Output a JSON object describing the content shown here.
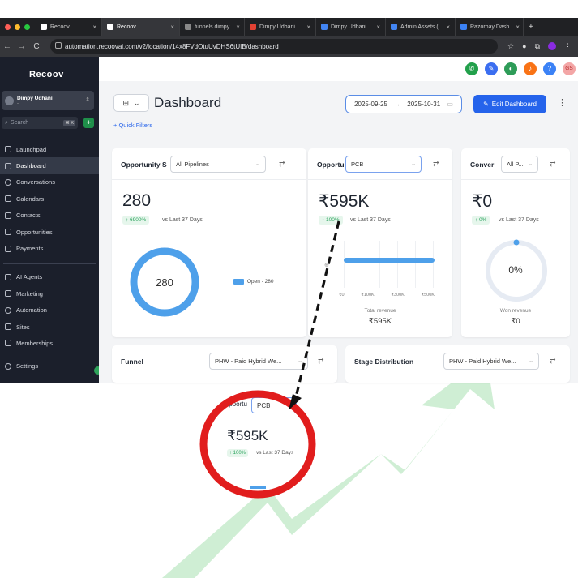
{
  "browser": {
    "tabs": [
      {
        "label": "Recoov",
        "color": "#ffffff",
        "active": false
      },
      {
        "label": "Recoov",
        "color": "#ffffff",
        "active": true
      },
      {
        "label": "funnels.dimpy",
        "color": "#888888",
        "active": false
      },
      {
        "label": "Dimpy Udhani",
        "color": "#4285f4",
        "active": false
      },
      {
        "label": "Dimpy Udhani",
        "color": "#4285f4",
        "active": false
      },
      {
        "label": "Admin Assets (",
        "color": "#4285f4",
        "active": false
      },
      {
        "label": "Razorpay Dash",
        "color": "#3b82f6",
        "active": false
      }
    ],
    "new_tab": "+",
    "url": "automation.recoovai.com/v2/location/14x8FVdOtuUvDHS6tUIB/dashboard"
  },
  "sidebar": {
    "logo": "Recoov",
    "account_name": "Dimpy Udhani",
    "account_sub": "-",
    "search_placeholder": "Search",
    "search_shortcut": "⌘ K",
    "items": [
      {
        "label": "Launchpad",
        "icon": "rocket-icon"
      },
      {
        "label": "Dashboard",
        "icon": "dashboard-icon",
        "active": true
      },
      {
        "label": "Conversations",
        "icon": "chat-icon"
      },
      {
        "label": "Calendars",
        "icon": "calendar-icon"
      },
      {
        "label": "Contacts",
        "icon": "contacts-icon"
      },
      {
        "label": "Opportunities",
        "icon": "opportunities-icon"
      },
      {
        "label": "Payments",
        "icon": "payments-icon"
      }
    ],
    "items2": [
      {
        "label": "AI Agents",
        "icon": "ai-icon"
      },
      {
        "label": "Marketing",
        "icon": "send-icon"
      },
      {
        "label": "Automation",
        "icon": "automation-icon"
      },
      {
        "label": "Sites",
        "icon": "sites-icon"
      },
      {
        "label": "Memberships",
        "icon": "memberships-icon"
      }
    ],
    "settings": "Settings"
  },
  "header": {
    "avatar_initials": "GS",
    "page_title": "Dashboard",
    "date_from": "2025-09-25",
    "date_to": "2025-10-31",
    "edit_button": "Edit Dashboard",
    "quick_filters": "+ Quick Filters"
  },
  "cards": {
    "opportunity_status": {
      "title": "Opportunity S",
      "select": "All Pipelines",
      "value": "280",
      "change": "↑ 6900%",
      "vs": "vs Last 37 Days",
      "donut_value": "280",
      "legend": "Open - 280"
    },
    "opportunity_value": {
      "title": "Opportu",
      "select": "PCB",
      "value": "₹595K",
      "change": "↑ 100%",
      "vs": "vs Last 37 Days",
      "ticks": [
        "₹0",
        "₹100K",
        "₹300K",
        "₹500K"
      ],
      "bar_fraction": 1.0,
      "footer_label": "Total revenue",
      "footer_value": "₹595K"
    },
    "conversion": {
      "title": "Conver",
      "select": "All P...",
      "value": "₹0",
      "change": "↑ 0%",
      "vs": "vs Last 37 Days",
      "gauge": "0%",
      "footer_label": "Won revenue",
      "footer_value": "₹0"
    },
    "funnel": {
      "title": "Funnel",
      "select": "PHW - Paid Hybrid We..."
    },
    "stage": {
      "title": "Stage Distribution",
      "select": "PHW - Paid Hybrid We..."
    }
  },
  "zoom": {
    "title": "Opportu",
    "select": "PCB",
    "value": "₹595K",
    "change": "↑ 100%",
    "vs": "vs Last 37 Days"
  },
  "colors": {
    "accent": "#2563eb",
    "sidebar_bg": "#1b1f2b",
    "highlight_circle": "#e11d1d",
    "donut": "#4ea0ea",
    "arrow_bg": "#8fd49a"
  }
}
